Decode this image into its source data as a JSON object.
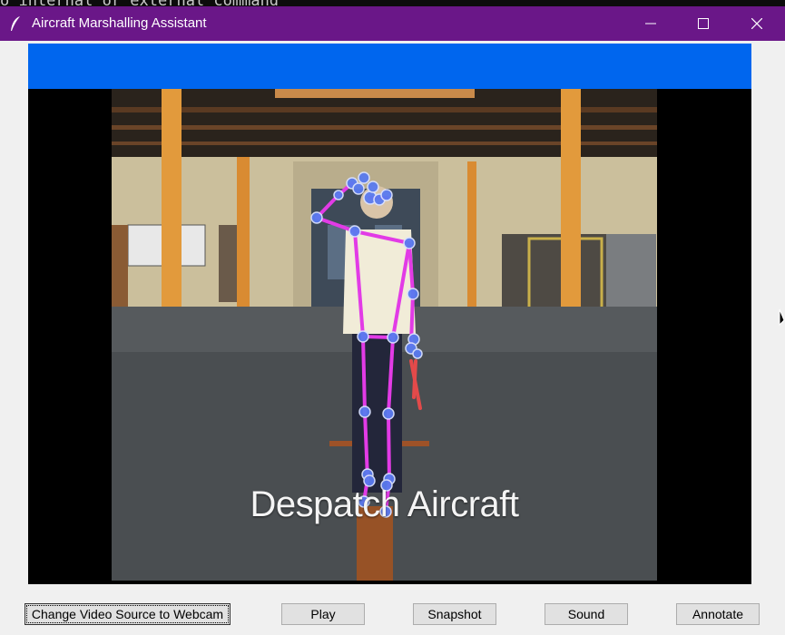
{
  "background": {
    "terminal_text": "o internal or external command"
  },
  "window": {
    "title": "Aircraft Marshalling Assistant",
    "icons": {
      "app": "feather-icon",
      "minimize": "minimize-icon",
      "maximize": "maximize-icon",
      "close": "close-icon"
    },
    "title_bar_color": "#6a1788",
    "accent_bar_color": "#0066ee"
  },
  "video": {
    "caption": "Despatch Aircraft",
    "skeleton_color": "#e23be6",
    "landmark_color": "#5a7bf0"
  },
  "buttons": {
    "webcam": "Change Video Source to Webcam",
    "play": "Play",
    "snapshot": "Snapshot",
    "sound": "Sound",
    "annotate": "Annotate"
  }
}
